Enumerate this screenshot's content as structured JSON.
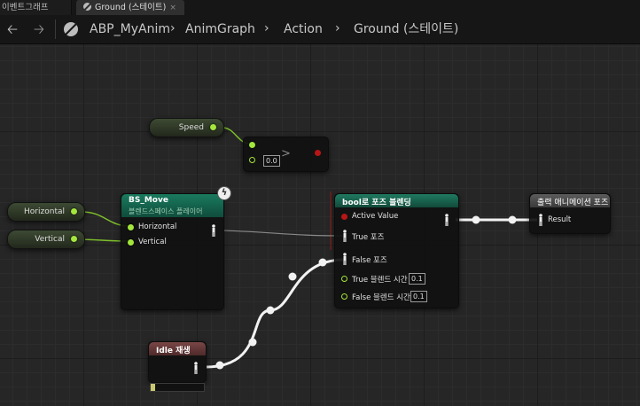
{
  "tabs": [
    {
      "label": "이벤트그래프",
      "active": false
    },
    {
      "label": "Ground (스테이트)",
      "active": true,
      "close": "×"
    }
  ],
  "breadcrumb": {
    "back_icon": "left-arrow-icon",
    "forward_icon": "right-arrow-icon",
    "root": "ABP_MyAnim",
    "items": [
      "AnimGraph",
      "Action",
      "Ground (스테이트)"
    ]
  },
  "nodes": {
    "speed": {
      "label": "Speed"
    },
    "compare": {
      "operator": ">",
      "value": "0.0"
    },
    "horizontal": {
      "label": "Horizontal"
    },
    "vertical": {
      "label": "Vertical"
    },
    "bs_move": {
      "title": "BS_Move",
      "subtitle": "블렌드스페이스 플레이어",
      "pins": [
        "Horizontal",
        "Vertical"
      ]
    },
    "blend": {
      "title": "bool로 포즈 블렌딩",
      "pins": [
        "Active Value",
        "True 포즈",
        "False 포즈",
        "True 블렌드 시간",
        "False 블렌드 시간"
      ],
      "true_time": "0.1",
      "false_time": "0.1"
    },
    "output": {
      "title": "출력 애니메이션 포즈",
      "pin": "Result"
    },
    "idle": {
      "title": "Idle 재생"
    }
  },
  "colors": {
    "float_pin": "#a4e63c",
    "bool_pin": "#b81616",
    "blend_header": "#1f7a60",
    "output_header": "#555555",
    "idle_header": "#6b3c3c"
  }
}
